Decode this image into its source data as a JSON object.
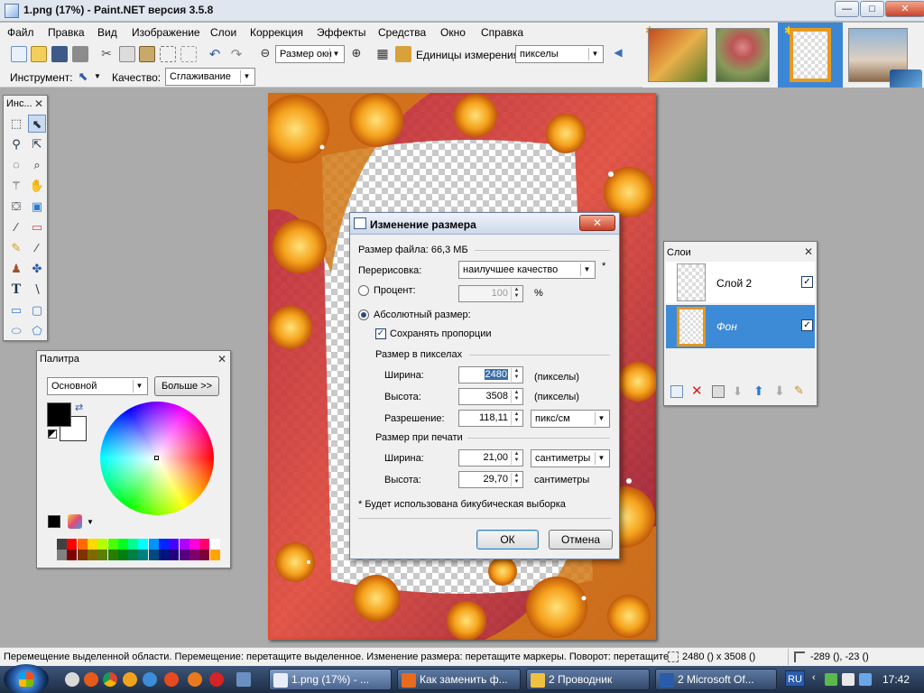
{
  "window": {
    "title": "1.png (17%) - Paint.NET версия 3.5.8",
    "buttons": {
      "minimize": "—",
      "maximize": "□",
      "close": "✕"
    }
  },
  "menu": [
    "Файл",
    "Правка",
    "Вид",
    "Изображение",
    "Слои",
    "Коррекция",
    "Эффекты",
    "Средства",
    "Окно",
    "Справка"
  ],
  "toolbar": {
    "zoom_value": "Размер окн",
    "units_label": "Единицы измерения:",
    "units_value": "пикселы",
    "tool_label": "Инструмент:",
    "quality_label": "Качество:",
    "quality_value": "Сглаживание"
  },
  "tools_panel": {
    "title": "Инс..."
  },
  "palette_panel": {
    "title": "Палитра",
    "mode_value": "Основной",
    "more_button": "Больше >>",
    "primary_color": "#000000",
    "secondary_color": "#ffffff",
    "swatches": [
      "#404040",
      "#ff0000",
      "#ff6a00",
      "#ffd800",
      "#b6ff00",
      "#4cff00",
      "#00ff21",
      "#00ff90",
      "#00ffff",
      "#0094ff",
      "#0026ff",
      "#4800ff",
      "#b200ff",
      "#ff00dc",
      "#ff006e",
      "#ffffff",
      "#808080",
      "#7f0000",
      "#7f3300",
      "#7f6a00",
      "#5b7f00",
      "#267f00",
      "#007f0e",
      "#007f46",
      "#007f7f",
      "#004a7f",
      "#00137f",
      "#21007f",
      "#57007f",
      "#7f006e",
      "#7f0037",
      "#ffa500"
    ]
  },
  "layers_panel": {
    "title": "Слои",
    "layers": [
      {
        "name": "Слой 2",
        "checked": "✓",
        "selected": false
      },
      {
        "name": "Фон",
        "checked": "✓",
        "selected": true
      }
    ]
  },
  "dialog": {
    "title": "Изменение размера",
    "file_size": "Размер файла: 66,3 МБ",
    "resample_label": "Перерисовка:",
    "resample_value": "наилучшее качество",
    "asterisk": "*",
    "percent_label": "Процент:",
    "percent_value": "100",
    "percent_unit": "%",
    "absolute_label": "Абсолютный размер:",
    "keep_ratio_label": "Сохранять пропорции",
    "pixel_size_header": "Размер в пикселах",
    "width_label": "Ширина:",
    "width_px": "2480",
    "width_px_unit": "(пикселы)",
    "height_label": "Высота:",
    "height_px": "3508",
    "height_px_unit": "(пикселы)",
    "resolution_label": "Разрешение:",
    "resolution_value": "118,11",
    "resolution_unit": "пикс/см",
    "print_size_header": "Размер при печати",
    "print_width_label": "Ширина:",
    "print_width": "21,00",
    "print_width_unit": "сантиметры",
    "print_height_label": "Высота:",
    "print_height": "29,70",
    "print_height_unit": "сантиметры",
    "footnote": "* Будет использована бикубическая выборка",
    "ok": "ОК",
    "cancel": "Отмена"
  },
  "statusbar": {
    "hint": "Перемещение выделенной области. Перемещение: перетащите выделенное. Изменение размера: перетащите маркеры. Поворот: перетащите",
    "size": "2480 () x 3508 ()",
    "coords": "-289 (), -23 ()"
  },
  "taskbar": {
    "tasks": [
      {
        "label": "1.png (17%) - ...",
        "color": "#e8eef8"
      },
      {
        "label": "Как заменить ф...",
        "color": "#e66b1f"
      },
      {
        "label": "2 Проводник",
        "color": "#f0c040"
      },
      {
        "label": "2 Microsoft Of...",
        "color": "#2a5caa"
      }
    ],
    "lang": "RU",
    "clock": "17:42"
  }
}
